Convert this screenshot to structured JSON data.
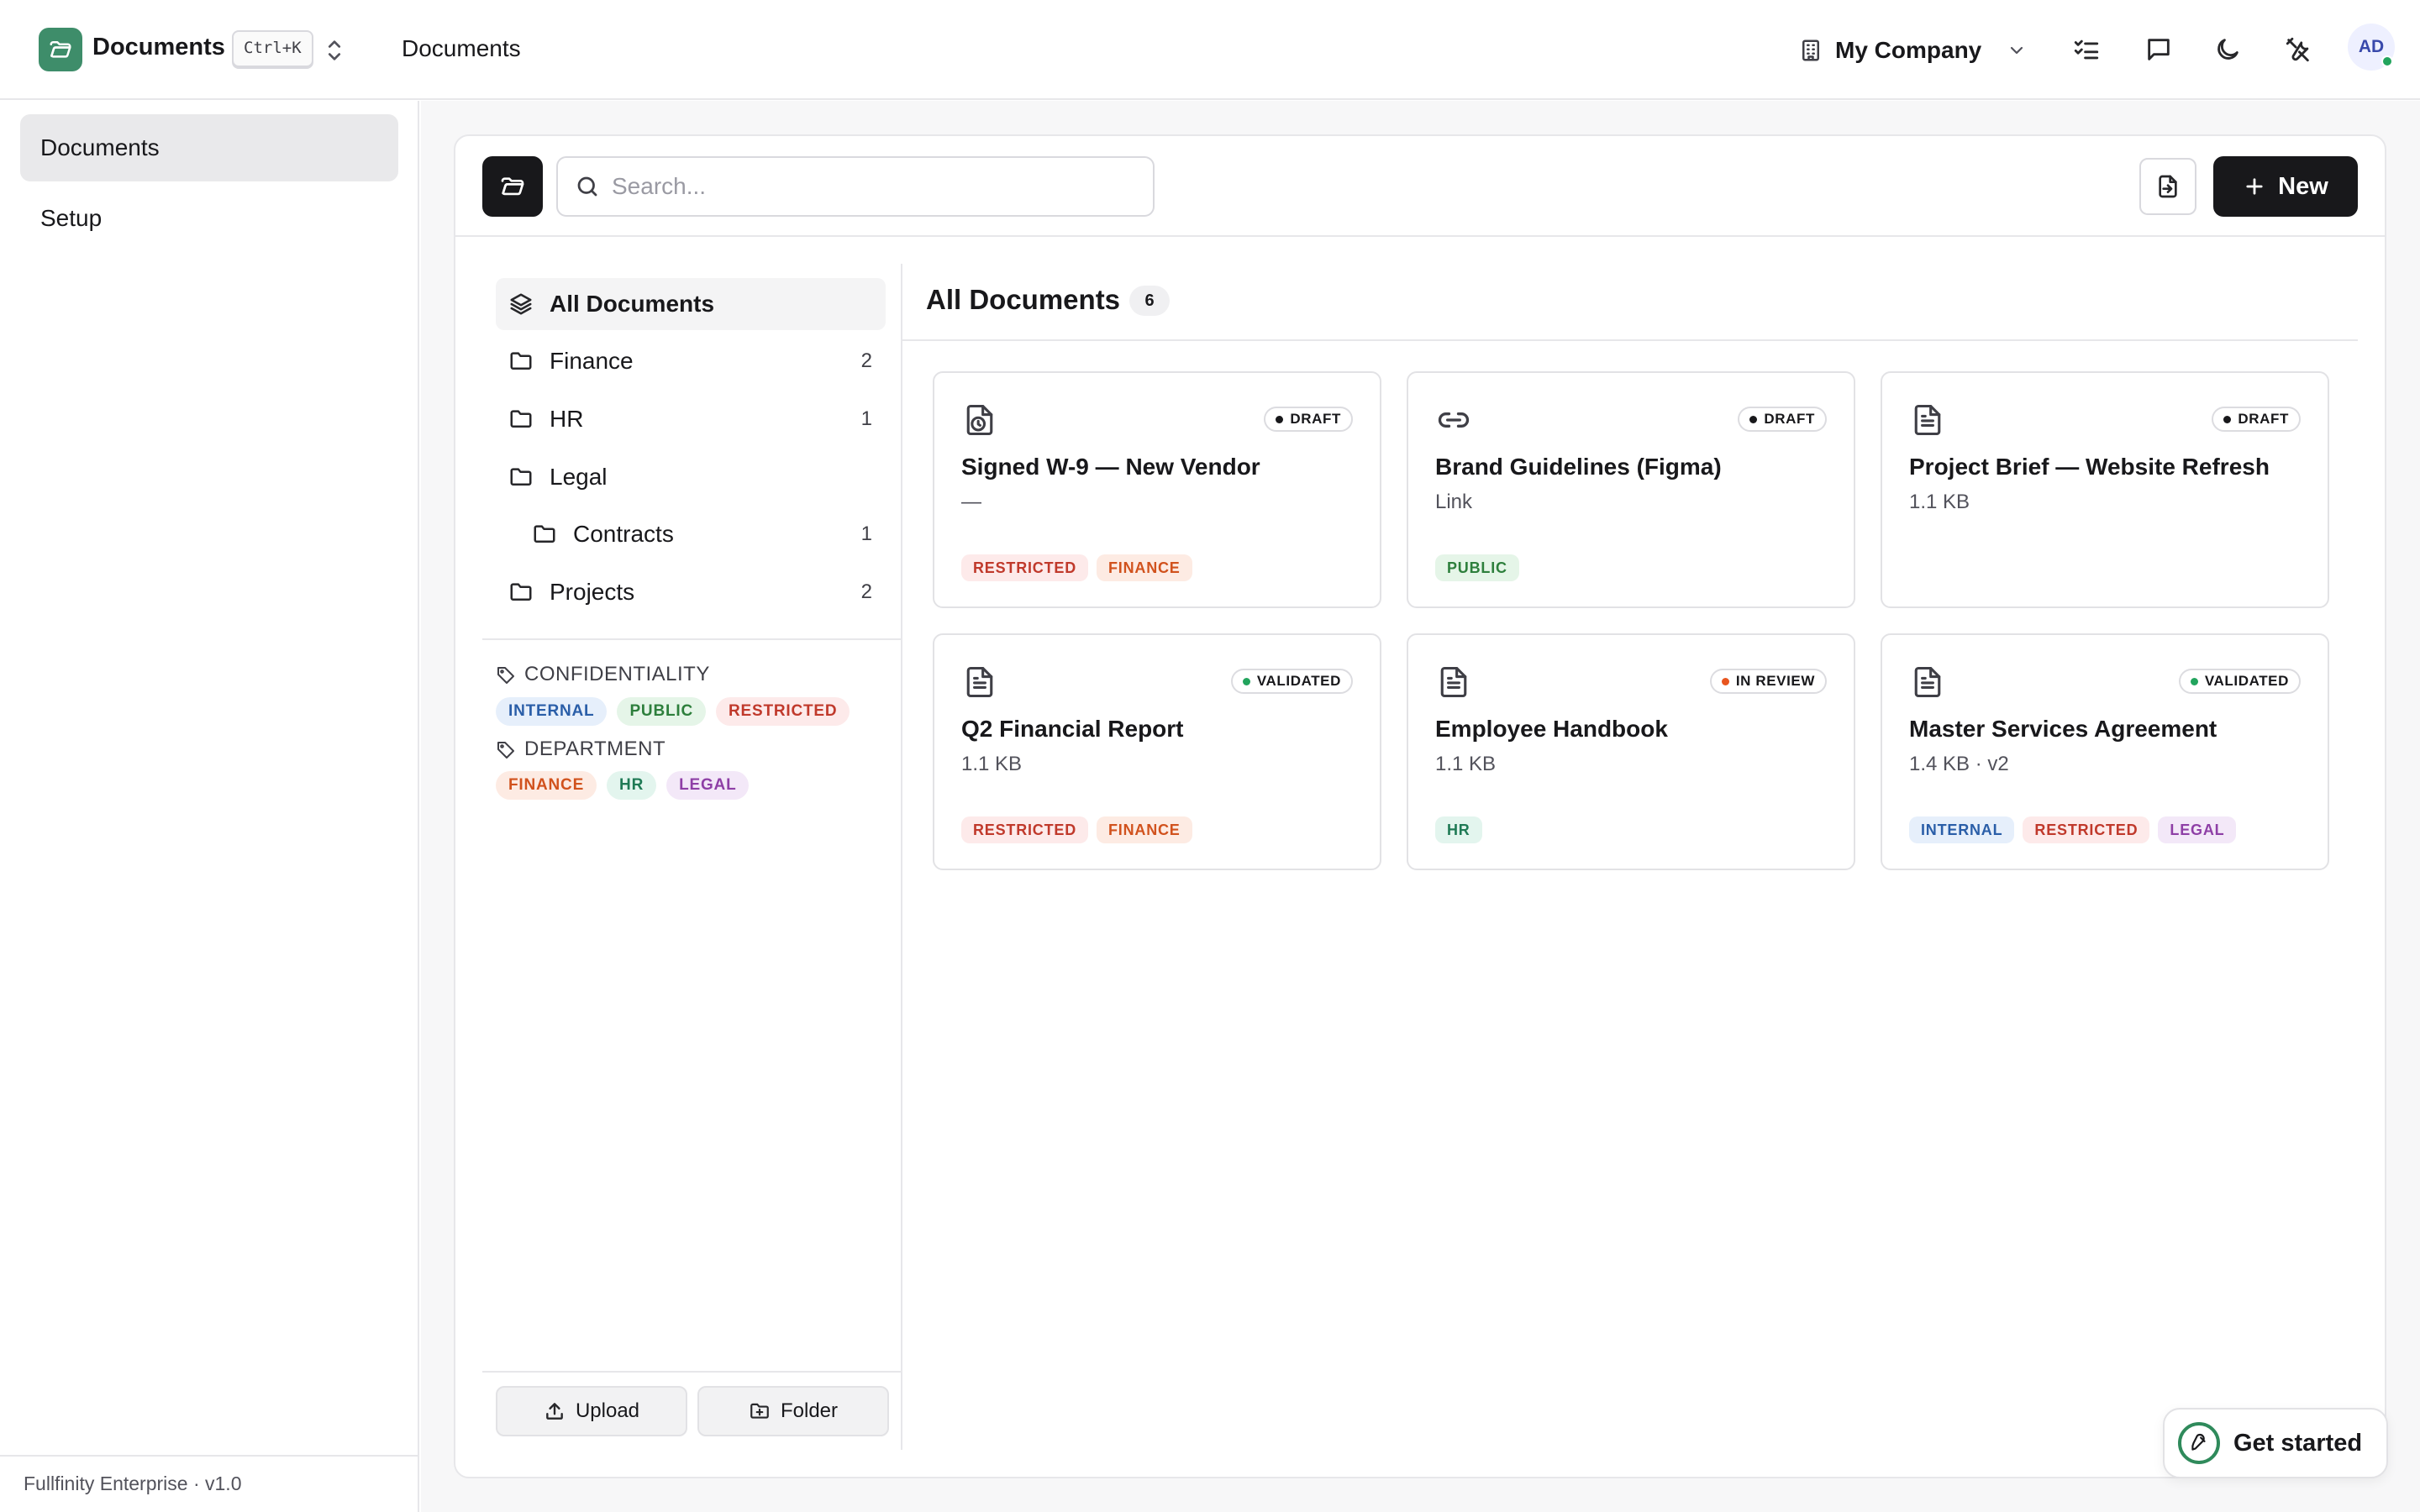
{
  "app": {
    "name": "Documents",
    "shortcut": "Ctrl+K",
    "breadcrumb": "Documents",
    "brand_color": "#3e8d6a"
  },
  "header": {
    "company": "My Company",
    "avatar_initials": "AD",
    "icons": [
      "building-icon",
      "chevron-down-icon",
      "checklist-icon",
      "chat-icon",
      "moon-icon",
      "tools-icon"
    ]
  },
  "sidebar": {
    "items": [
      {
        "label": "Documents",
        "active": true
      },
      {
        "label": "Setup",
        "active": false
      }
    ],
    "footer": "Fullfinity Enterprise · v1.0"
  },
  "toolbar": {
    "search_placeholder": "Search...",
    "new_label": "New"
  },
  "tree": {
    "items": [
      {
        "label": "All Documents",
        "count": ""
      },
      {
        "label": "Finance",
        "count": "2"
      },
      {
        "label": "HR",
        "count": "1"
      },
      {
        "label": "Legal",
        "count": ""
      },
      {
        "label": "Contracts",
        "count": "1"
      },
      {
        "label": "Projects",
        "count": "2"
      }
    ],
    "facets": {
      "confidentiality": {
        "title": "CONFIDENTIALITY",
        "tags": [
          "INTERNAL",
          "PUBLIC",
          "RESTRICTED"
        ]
      },
      "department": {
        "title": "DEPARTMENT",
        "tags": [
          "FINANCE",
          "HR",
          "LEGAL"
        ]
      }
    },
    "upload_label": "Upload",
    "folder_label": "Folder"
  },
  "content": {
    "title": "All Documents",
    "count": "6",
    "cards": [
      {
        "title": "Signed W-9 — New Vendor",
        "sub": "—",
        "status": "DRAFT",
        "tags": [
          "RESTRICTED",
          "FINANCE"
        ]
      },
      {
        "title": "Brand Guidelines (Figma)",
        "sub": "Link",
        "status": "DRAFT",
        "tags": [
          "PUBLIC"
        ]
      },
      {
        "title": "Project Brief — Website Refresh",
        "sub": "1.1 KB",
        "status": "DRAFT",
        "tags": []
      },
      {
        "title": "Q2 Financial Report",
        "sub": "1.1 KB",
        "status": "VALIDATED",
        "tags": [
          "RESTRICTED",
          "FINANCE"
        ]
      },
      {
        "title": "Employee Handbook",
        "sub": "1.1 KB",
        "status": "IN REVIEW",
        "tags": [
          "HR"
        ]
      },
      {
        "title": "Master Services Agreement",
        "sub": "1.4 KB · v2",
        "status": "VALIDATED",
        "tags": [
          "INTERNAL",
          "RESTRICTED",
          "LEGAL"
        ]
      }
    ]
  },
  "get_started": {
    "label": "Get started"
  }
}
